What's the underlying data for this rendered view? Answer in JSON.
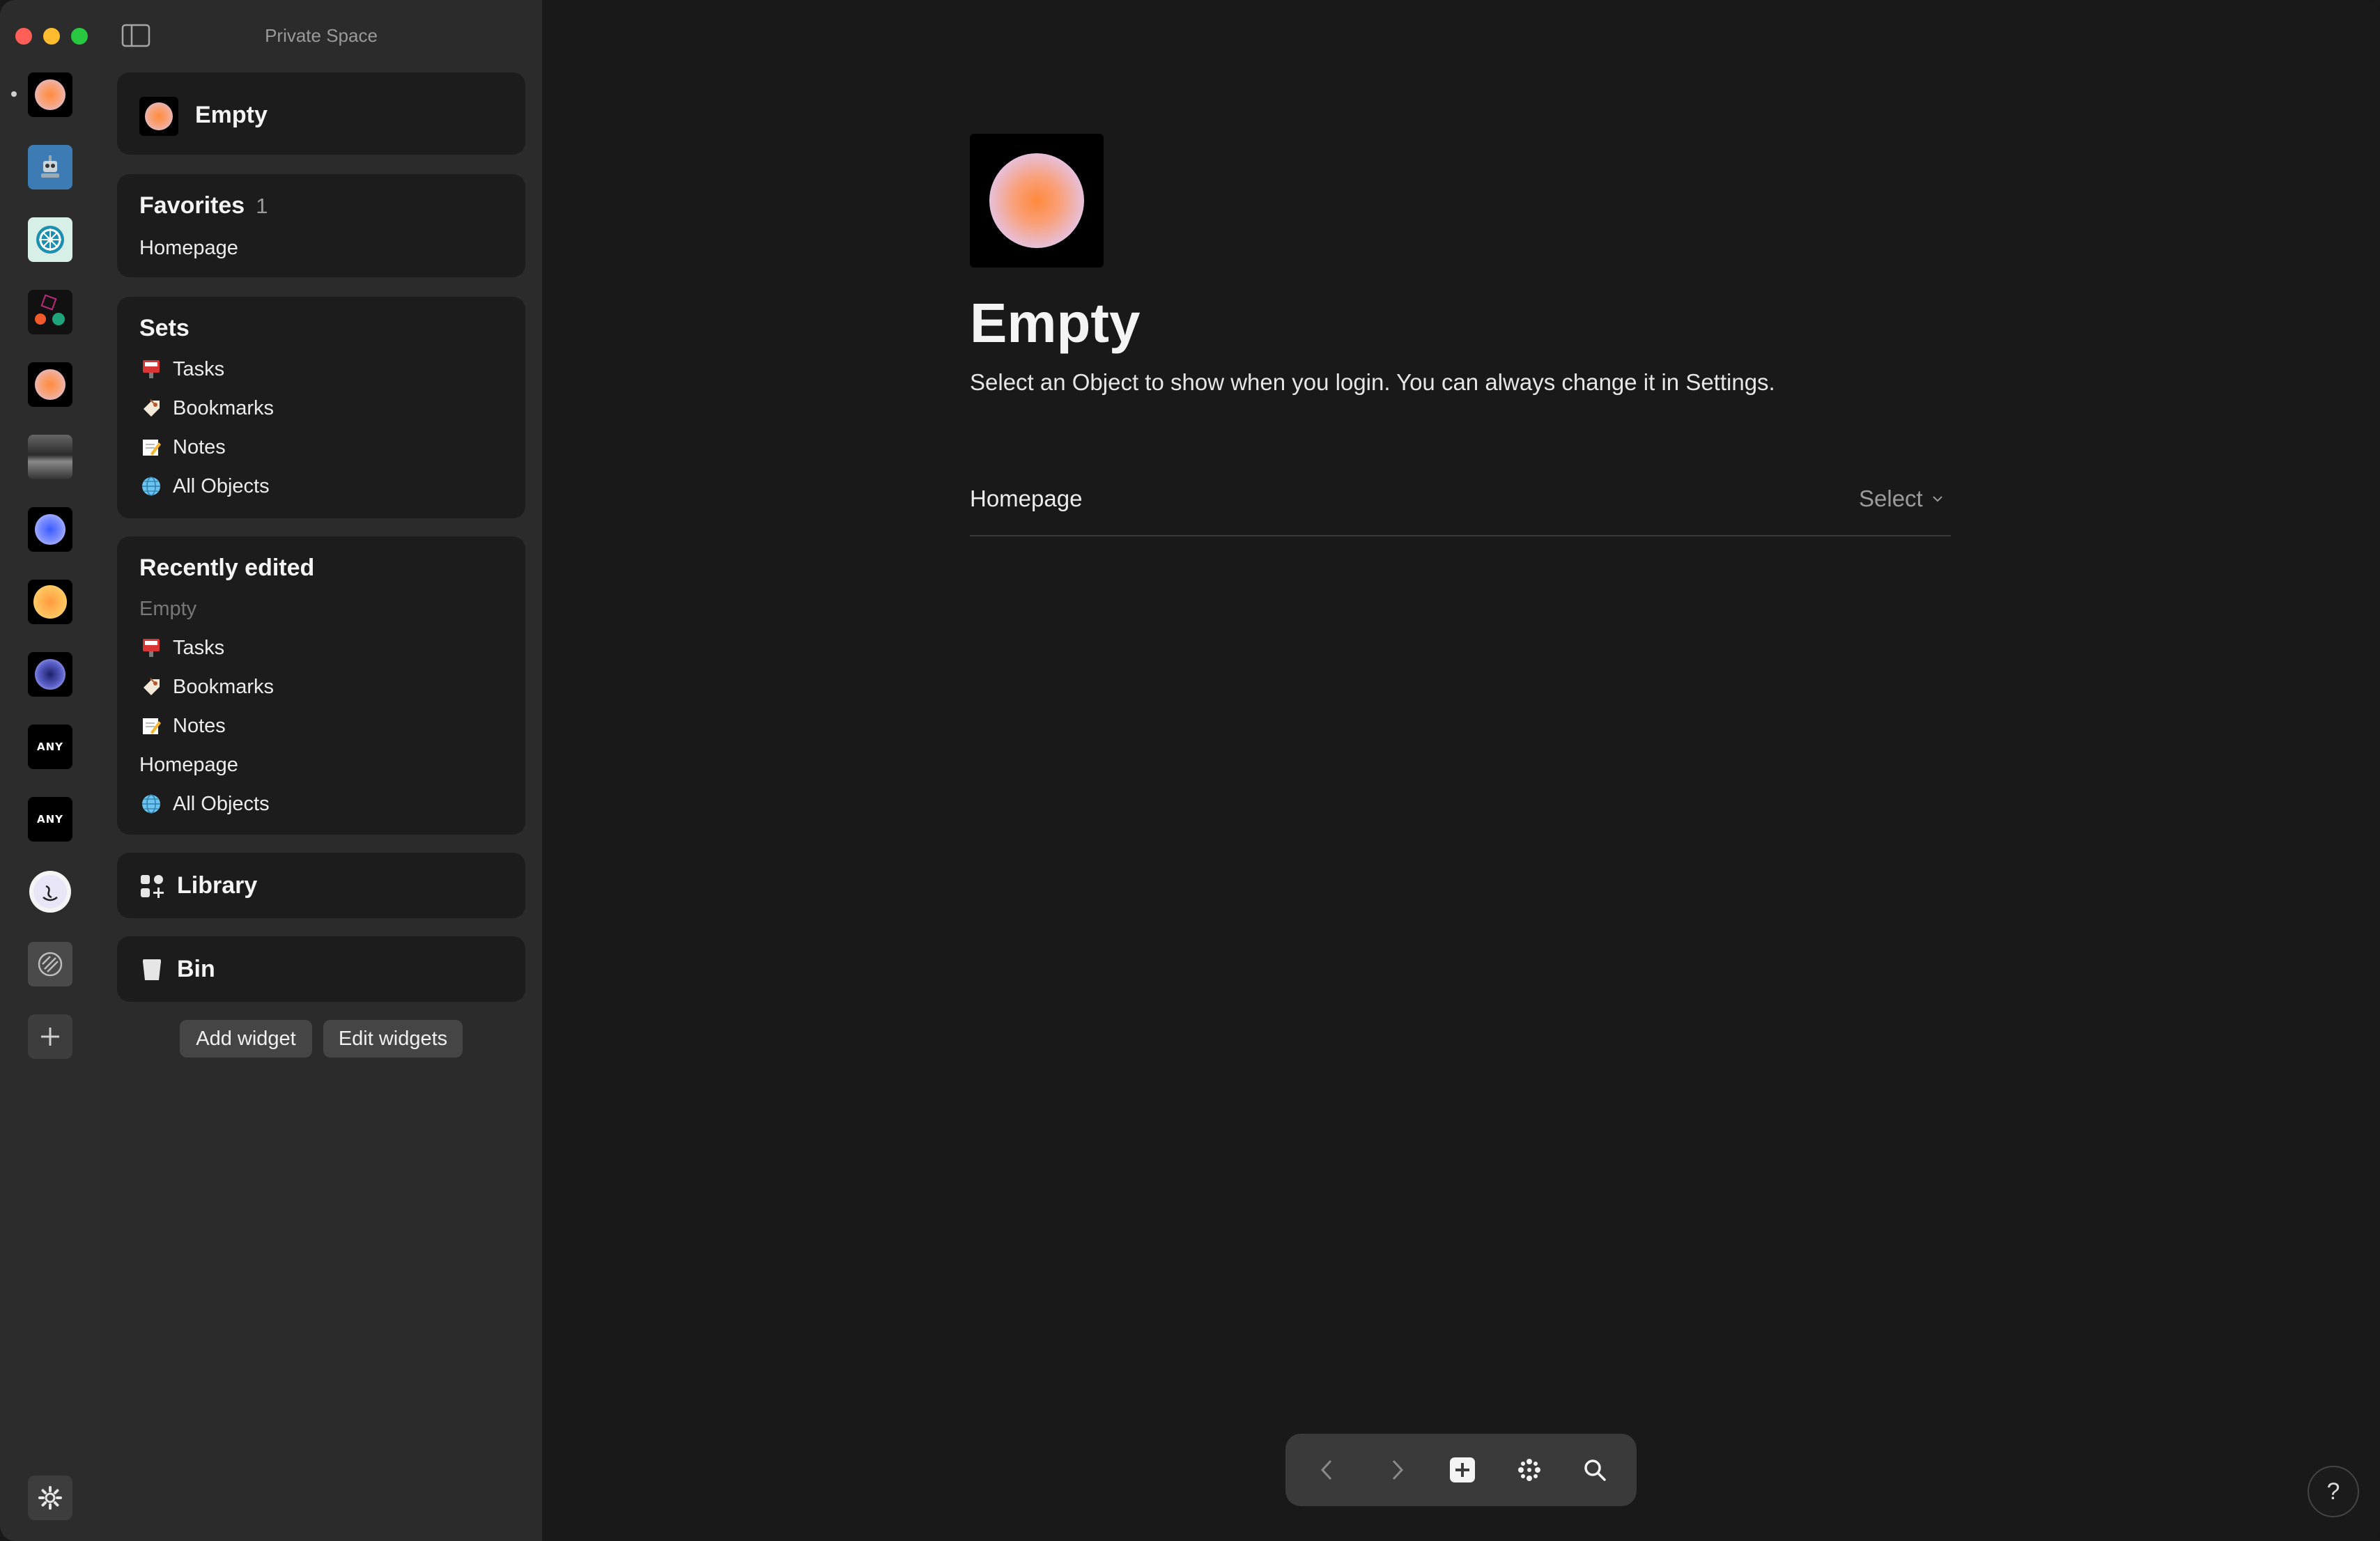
{
  "window": {
    "title": "Private Space"
  },
  "colors": {
    "close": "#ff5f57",
    "minimize": "#febc2e",
    "zoom": "#28c840",
    "accent": "#ff8a3d"
  },
  "rail": {
    "spaces": [
      {
        "name": "space-gradient-orange"
      },
      {
        "name": "space-robot-image"
      },
      {
        "name": "space-wheel-image"
      },
      {
        "name": "space-shapes-image"
      },
      {
        "name": "space-gradient-orange-2"
      },
      {
        "name": "space-photo-image"
      },
      {
        "name": "space-gradient-blue"
      },
      {
        "name": "space-gradient-yellow"
      },
      {
        "name": "space-gradient-purple"
      },
      {
        "name": "space-any-1",
        "label": "ANY"
      },
      {
        "name": "space-any-2",
        "label": "ANY"
      },
      {
        "name": "space-smile"
      },
      {
        "name": "space-disabled"
      }
    ]
  },
  "sidebar": {
    "space_widget": {
      "label": "Empty"
    },
    "favorites": {
      "title": "Favorites",
      "count": "1",
      "items": [
        "Homepage"
      ]
    },
    "sets": {
      "title": "Sets",
      "items": [
        {
          "label": "Tasks",
          "icon": "tasks-icon"
        },
        {
          "label": "Bookmarks",
          "icon": "bookmark-icon"
        },
        {
          "label": "Notes",
          "icon": "notes-icon"
        },
        {
          "label": "All Objects",
          "icon": "globe-icon"
        }
      ]
    },
    "recent": {
      "title": "Recently edited",
      "items": [
        {
          "label": "Empty",
          "icon": ""
        },
        {
          "label": "Tasks",
          "icon": "tasks-icon"
        },
        {
          "label": "Bookmarks",
          "icon": "bookmark-icon"
        },
        {
          "label": "Notes",
          "icon": "notes-icon"
        },
        {
          "label": "Homepage",
          "icon": ""
        },
        {
          "label": "All Objects",
          "icon": "globe-icon"
        }
      ]
    },
    "library": {
      "label": "Library"
    },
    "bin": {
      "label": "Bin"
    },
    "add_widget": "Add widget",
    "edit_widgets": "Edit widgets"
  },
  "main": {
    "title": "Empty",
    "subtitle": "Select an Object to show when you login. You can always change it in Settings.",
    "row_label": "Homepage",
    "row_select": "Select"
  },
  "help": "?"
}
